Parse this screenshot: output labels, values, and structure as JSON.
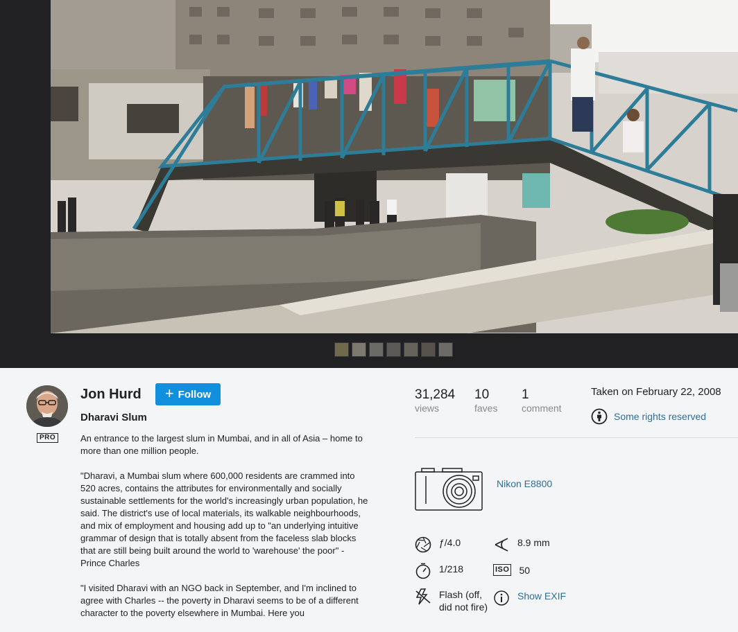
{
  "photo": {
    "alt": "Dharavi Slum"
  },
  "owner": {
    "name": "Jon Hurd",
    "badge": "PRO",
    "follow_label": "Follow"
  },
  "title": "Dharavi Slum",
  "description": [
    "An entrance to the largest slum in Mumbai, and in all of Asia – home to more than one million people.",
    "\"Dharavi, a Mumbai slum where 600,000 residents are crammed into 520 acres, contains the attributes for environmentally and socially sustainable settlements for the world's increasingly urban population, he said. The district's use of local materials, its walkable neighbourhoods, and mix of employment and housing add up to \"an underlying intuitive grammar of design that is totally absent from the faceless slab blocks that are still being built around the world to 'warehouse' the poor\" - Prince Charles",
    "\"I visited Dharavi with an NGO back in September, and I'm inclined to agree with Charles -- the poverty in Dharavi seems to be of a different character to the poverty elsewhere in Mumbai. Here you"
  ],
  "stats": {
    "views": {
      "value": "31,284",
      "label": "views"
    },
    "faves": {
      "value": "10",
      "label": "faves"
    },
    "comments": {
      "value": "1",
      "label": "comment"
    }
  },
  "taken": "Taken on February 22, 2008",
  "license": {
    "icon": "attribution-icon",
    "label": "Some rights reserved"
  },
  "camera": {
    "icon": "camera-icon",
    "model": "Nikon E8800"
  },
  "exif": {
    "aperture": "ƒ/4.0",
    "focal_length": "8.9 mm",
    "shutter": "1/218",
    "iso_label": "ISO",
    "iso": "50",
    "flash_line1": "Flash (off,",
    "flash_line2": "did not fire)",
    "show_exif": "Show EXIF"
  },
  "colors": {
    "accent": "#128fdc",
    "link": "#2d6d9a",
    "viewer_bg": "#212124",
    "muted": "#898989"
  }
}
